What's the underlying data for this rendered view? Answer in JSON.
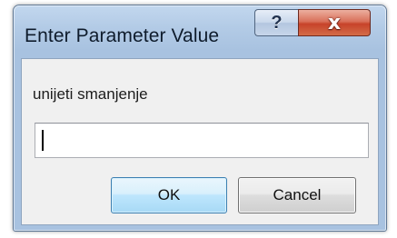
{
  "dialog": {
    "title": "Enter Parameter Value",
    "help_glyph": "?",
    "close_glyph": "x",
    "prompt": "unijeti smanjenje",
    "input_value": "",
    "ok_label": "OK",
    "cancel_label": "Cancel"
  },
  "icons": {
    "help": "help-icon",
    "close": "close-icon"
  },
  "colors": {
    "frame": "#b3cbe6",
    "close_button": "#c7432a",
    "default_button_border": "#3c7fb1",
    "client_background": "#f0f0f0"
  }
}
